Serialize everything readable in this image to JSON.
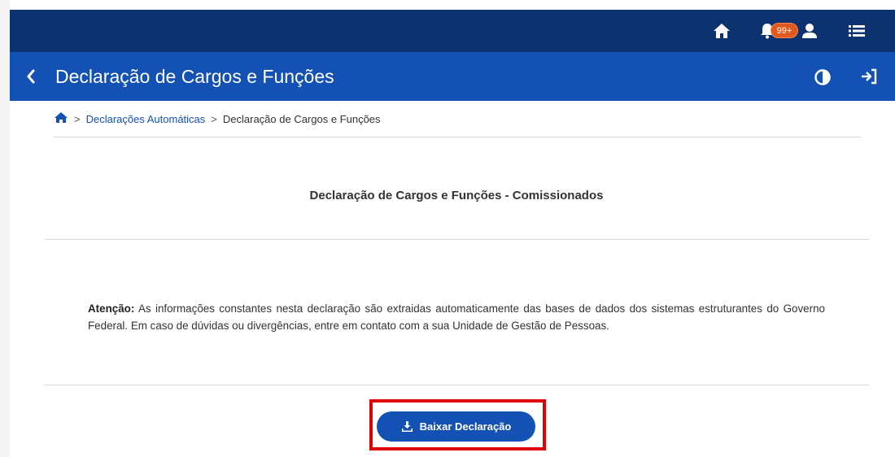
{
  "header": {
    "notification_count": "99+"
  },
  "titlebar": {
    "title": "Declaração de Cargos e Funções"
  },
  "breadcrumb": {
    "separator": ">",
    "items": [
      "Declarações Automáticas",
      "Declaração de Cargos e Funções"
    ]
  },
  "main": {
    "section_title": "Declaração de Cargos e Funções - Comissionados",
    "notice_label": "Atenção:",
    "notice_text": " As informações constantes nesta declaração são extraidas automaticamente das bases de dados dos sistemas estruturantes do Governo Federal. Em caso de dúvidas ou divergências, entre em contato com a sua Unidade de Gestão de Pessoas.",
    "download_label": "Baixar Declaração"
  },
  "icons": {
    "home": "home-icon",
    "notifications": "bell-icon",
    "user": "user-icon",
    "menu": "list-menu-icon",
    "back": "chevron-left-icon",
    "contrast": "contrast-icon",
    "sign_in": "sign-in-icon",
    "download": "download-icon"
  },
  "colors": {
    "topbar": "#0c326f",
    "titlebar": "#1351b4",
    "badge": "#e05a1f",
    "highlight": "#e00000",
    "link": "#1351b4"
  }
}
